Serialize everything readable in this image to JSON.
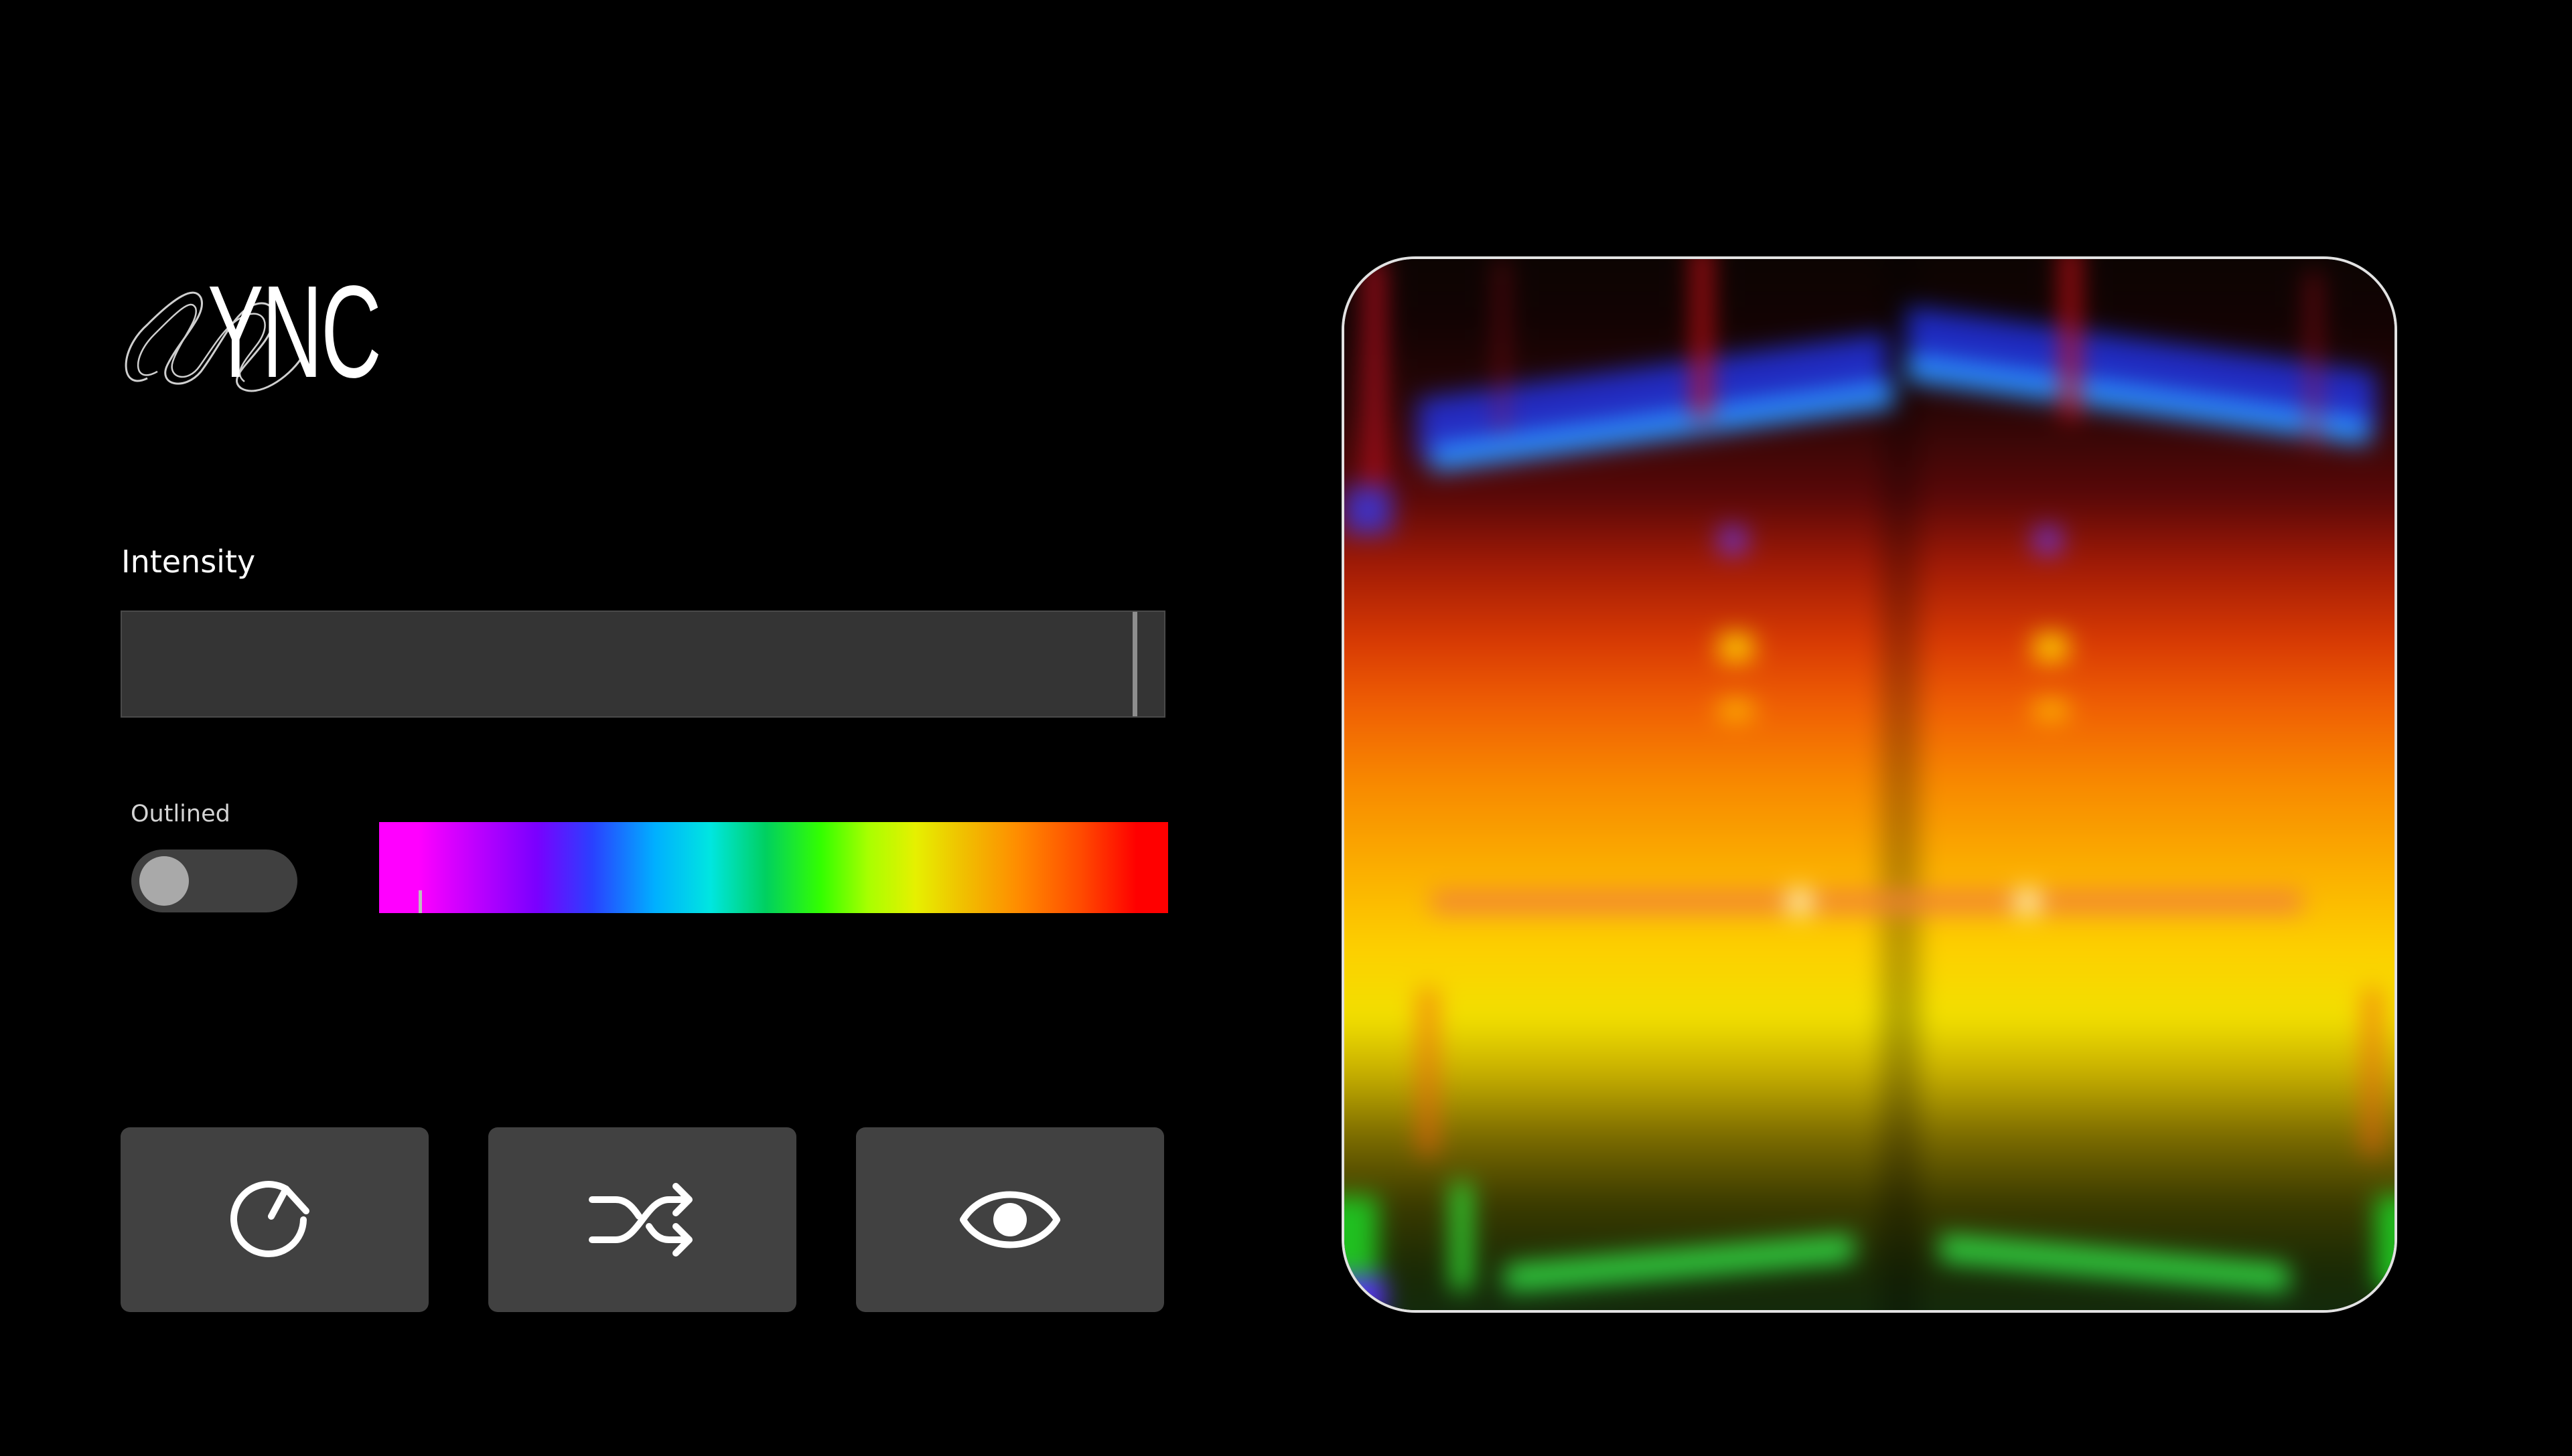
{
  "app": {
    "logo_text": "YNC",
    "logo_mark": "S"
  },
  "controls": {
    "intensity": {
      "label": "Intensity",
      "value": 0.97
    },
    "outlined": {
      "label": "Outlined",
      "on": false
    },
    "hue": {
      "value": 0.05,
      "colors": [
        "#ff00ff",
        "#7a00ff",
        "#2a40ff",
        "#00e6e0",
        "#33ff00",
        "#e6f000",
        "#ff8c00",
        "#ff0000"
      ]
    }
  },
  "actions": [
    {
      "name": "reset",
      "icon": "rotate-cw-icon"
    },
    {
      "name": "shuffle",
      "icon": "shuffle-icon"
    },
    {
      "name": "view",
      "icon": "eye-icon"
    }
  ],
  "preview": {
    "border_color": "#e2e2e2"
  }
}
